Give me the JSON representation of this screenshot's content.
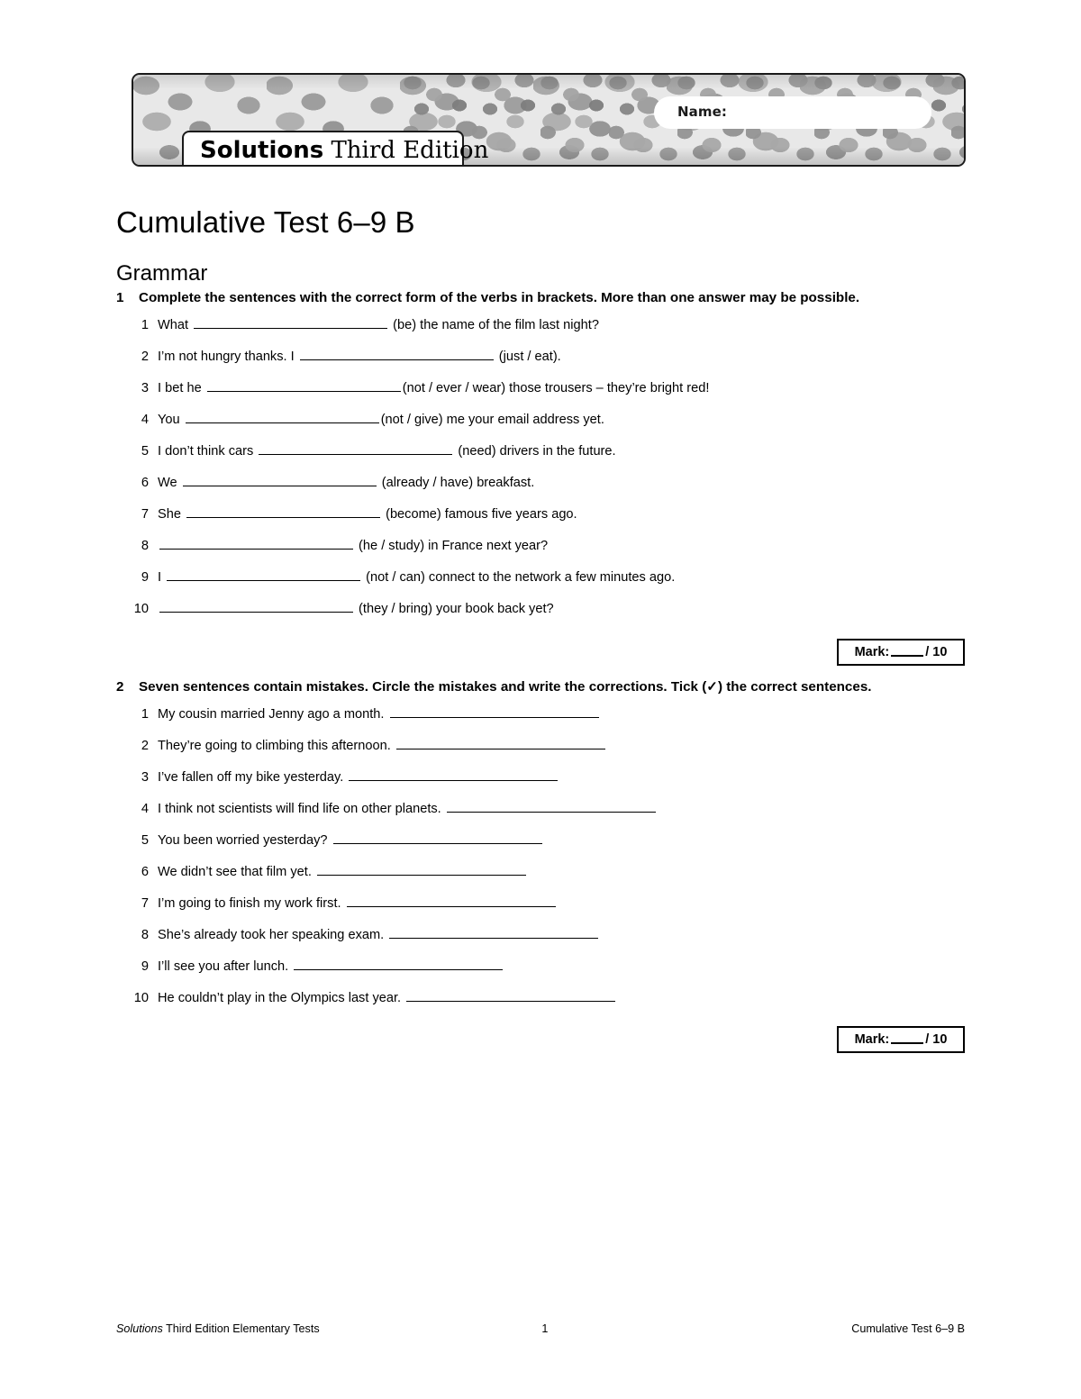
{
  "header": {
    "name_label": "Name:",
    "logo_bold": "Solutions",
    "logo_rest": " Third Edition",
    "banner_pattern": "pebble-mosaic-grayscale"
  },
  "document": {
    "title": "Cumulative Test 6–9 B",
    "section": "Grammar"
  },
  "exercises": [
    {
      "number": "1",
      "instruction": "Complete the sentences with the correct form of the verbs in brackets. More than one answer may be possible.",
      "items": [
        {
          "n": "1",
          "pre": "What ",
          "blank": 215,
          "post": " (be) the name of the film last night?"
        },
        {
          "n": "2",
          "pre": "I’m not hungry thanks. I ",
          "blank": 215,
          "post": " (just / eat)."
        },
        {
          "n": "3",
          "pre": "I bet he ",
          "blank": 215,
          "post": "(not / ever / wear) those trousers – they’re bright red!"
        },
        {
          "n": "4",
          "pre": "You ",
          "blank": 215,
          "post": "(not / give) me your email address yet."
        },
        {
          "n": "5",
          "pre": "I don’t think cars ",
          "blank": 215,
          "post": " (need) drivers in the future."
        },
        {
          "n": "6",
          "pre": "We ",
          "blank": 215,
          "post": " (already / have) breakfast."
        },
        {
          "n": "7",
          "pre": "She ",
          "blank": 215,
          "post": " (become) famous five years ago."
        },
        {
          "n": "8",
          "pre": "",
          "blank": 215,
          "post": " (he / study) in France next year?"
        },
        {
          "n": "9",
          "pre": "I ",
          "blank": 215,
          "post": " (not / can) connect to the network a few minutes ago."
        },
        {
          "n": "10",
          "pre": "",
          "blank": 215,
          "post": " (they / bring) your book back yet?"
        }
      ],
      "mark_label": "Mark:",
      "mark_total": "/ 10"
    },
    {
      "number": "2",
      "instruction": "Seven sentences contain mistakes. Circle the mistakes and write the corrections. Tick (✓) the correct sentences.",
      "items": [
        {
          "n": "1",
          "pre": "My cousin married Jenny ago a month. ",
          "blank": 232,
          "post": ""
        },
        {
          "n": "2",
          "pre": "They’re going to climbing this afternoon. ",
          "blank": 232,
          "post": ""
        },
        {
          "n": "3",
          "pre": "I’ve fallen off my bike yesterday. ",
          "blank": 232,
          "post": ""
        },
        {
          "n": "4",
          "pre": "I think not scientists will find life on other planets. ",
          "blank": 232,
          "post": ""
        },
        {
          "n": "5",
          "pre": "You been worried yesterday? ",
          "blank": 232,
          "post": ""
        },
        {
          "n": "6",
          "pre": "We didn’t see that film yet. ",
          "blank": 232,
          "post": ""
        },
        {
          "n": "7",
          "pre": "I’m going to finish my work first. ",
          "blank": 232,
          "post": ""
        },
        {
          "n": "8",
          "pre": "She’s already took her speaking exam. ",
          "blank": 232,
          "post": ""
        },
        {
          "n": "9",
          "pre": "I’ll see you after lunch. ",
          "blank": 232,
          "post": ""
        },
        {
          "n": "10",
          "pre": "He couldn’t play in the Olympics last year. ",
          "blank": 232,
          "post": ""
        }
      ],
      "mark_label": "Mark:",
      "mark_total": "/ 10"
    }
  ],
  "footer": {
    "left_italic": "Solutions",
    "left_rest": " Third Edition Elementary Tests",
    "page_number": "1",
    "right": "Cumulative Test 6–9 B"
  },
  "colors": {
    "ink": "#000000",
    "paper": "#ffffff",
    "banner_light": "#e8e8e8",
    "banner_mid": "#a9a9a9",
    "banner_dark": "#7e7e7e"
  }
}
